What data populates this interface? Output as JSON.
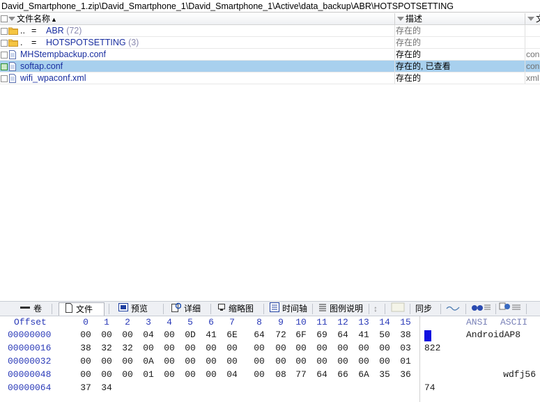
{
  "path": "David_Smartphone_1.zip\\David_Smartphone_1\\David_Smartphone_1\\Active\\data_backup\\ABR\\HOTSPOTSETTING",
  "columns": {
    "name": "文件名称",
    "desc": "描述",
    "ext": "文"
  },
  "rows": [
    {
      "icon": "folder",
      "dots": "..",
      "eq": "=",
      "name": "ABR",
      "count": "(72)",
      "desc": "存在的",
      "ext": ""
    },
    {
      "icon": "folder",
      "dots": ".",
      "eq": "=",
      "name": "HOTSPOTSETTING",
      "count": "(3)",
      "desc": "存在的",
      "ext": ""
    },
    {
      "icon": "file",
      "name": "MHStempbackup.conf",
      "desc": "存在的",
      "ext": "con"
    },
    {
      "icon": "file",
      "name": "softap.conf",
      "desc": "存在的, 已查看",
      "ext": "con",
      "selected": true
    },
    {
      "icon": "file",
      "name": "wifi_wpaconf.xml",
      "desc": "存在的",
      "ext": "xml"
    }
  ],
  "tabs": [
    {
      "label": "卷",
      "icon": "volume-icon"
    },
    {
      "label": "文件",
      "icon": "file-icon",
      "active": true
    },
    {
      "label": "预览",
      "icon": "preview-icon"
    },
    {
      "label": "详细",
      "icon": "details-icon"
    },
    {
      "label": "缩略图",
      "icon": "thumbnail-icon"
    },
    {
      "label": "时间轴",
      "icon": "timeline-icon"
    },
    {
      "label": "图例说明",
      "icon": "legend-icon"
    },
    {
      "label": "同步",
      "icon": "sync-icon"
    }
  ],
  "hex": {
    "offset_label": "Offset",
    "col_headers": [
      "0",
      "1",
      "2",
      "3",
      "4",
      "5",
      "6",
      "7",
      "8",
      "9",
      "10",
      "11",
      "12",
      "13",
      "14",
      "15"
    ],
    "ansi_label": "ANSI",
    "ascii_label": "ASCII",
    "rows": [
      {
        "offset": "00000000",
        "bytes": [
          "00",
          "00",
          "00",
          "04",
          "00",
          "0D",
          "41",
          "6E",
          "64",
          "72",
          "6F",
          "69",
          "64",
          "41",
          "50",
          "38"
        ],
        "text": "AndroidAP8"
      },
      {
        "offset": "00000016",
        "bytes": [
          "38",
          "32",
          "32",
          "00",
          "00",
          "00",
          "00",
          "00",
          "00",
          "00",
          "00",
          "00",
          "00",
          "00",
          "00",
          "03"
        ],
        "text": "822"
      },
      {
        "offset": "00000032",
        "bytes": [
          "00",
          "00",
          "00",
          "0A",
          "00",
          "00",
          "00",
          "00",
          "00",
          "00",
          "00",
          "00",
          "00",
          "00",
          "00",
          "01"
        ],
        "text": ""
      },
      {
        "offset": "00000048",
        "bytes": [
          "00",
          "00",
          "00",
          "01",
          "00",
          "00",
          "00",
          "04",
          "00",
          "08",
          "77",
          "64",
          "66",
          "6A",
          "35",
          "36"
        ],
        "text": "wdfj56"
      },
      {
        "offset": "00000064",
        "bytes": [
          "37",
          "34"
        ],
        "text": "74"
      }
    ]
  },
  "colors": {
    "selection": "#a8d0ee",
    "link": "#1a2fa0",
    "hex_header": "#2a3ab8",
    "cursor": "#1010e0"
  }
}
